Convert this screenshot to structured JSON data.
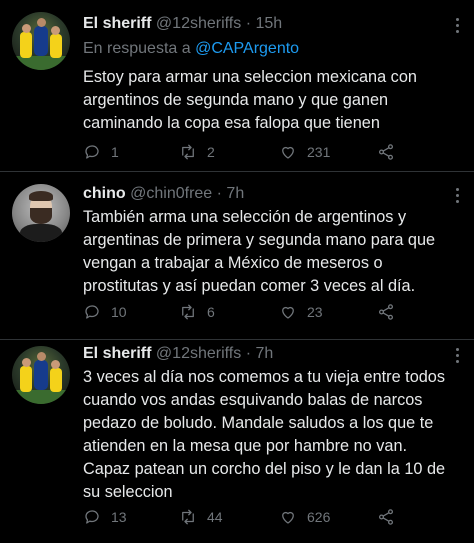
{
  "tweets": [
    {
      "display_name": "El sheriff",
      "handle": "@12sheriffs",
      "separator": "·",
      "time": "15h",
      "reply_prefix": "En respuesta a",
      "reply_mention": "@CAPArgento",
      "text": "Estoy para armar una seleccion mexicana con\nargentinos de segunda mano y que ganen\ncaminando la copa esa falopa que tienen",
      "replies": "1",
      "retweets": "2",
      "likes": "231",
      "avatar_icon": "team-photo-avatar"
    },
    {
      "display_name": "chino",
      "handle": "@chin0free",
      "separator": "·",
      "time": "7h",
      "text": "También arma una selección de argentinos y\nargentinas de primera y segunda mano para que\nvengan a trabajar a México de meseros o\nprostitutas y así puedan comer 3 veces al día.",
      "replies": "10",
      "retweets": "6",
      "likes": "23",
      "avatar_icon": "bearded-man-avatar"
    },
    {
      "display_name": "El sheriff",
      "handle": "@12sheriffs",
      "separator": "·",
      "time": "7h",
      "text": "3 veces al día nos comemos a tu vieja entre todos\ncuando vos andas esquivando balas de narcos\npedazo de boludo. Mandale saludos a los que te\natienden en la mesa que por hambre no van.\nCapaz patean un corcho del piso y le dan la 10 de\nsu seleccion",
      "replies": "13",
      "retweets": "44",
      "likes": "626",
      "avatar_icon": "team-photo-avatar"
    }
  ],
  "colors": {
    "background": "#000000",
    "text": "#e7e9ea",
    "muted": "#71767b",
    "mention": "#1d9bf0",
    "divider": "#2f3336"
  },
  "icons": [
    "reply-icon",
    "retweet-icon",
    "like-icon",
    "share-icon",
    "more-options-icon"
  ]
}
